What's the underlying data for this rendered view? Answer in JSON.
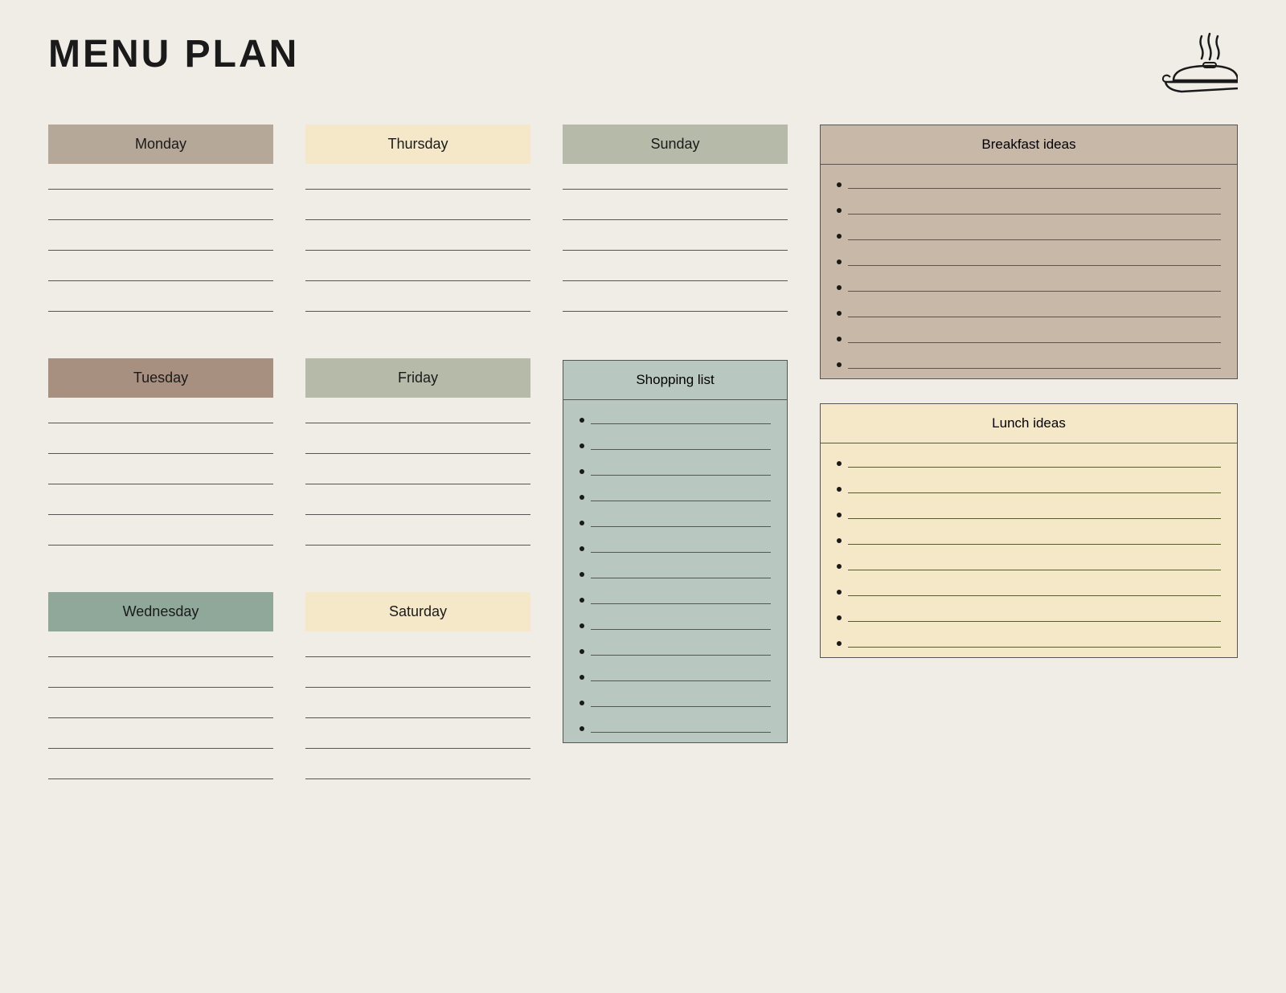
{
  "title": "MENU PLAN",
  "days": {
    "monday": {
      "label": "Monday",
      "color_class": "monday",
      "lines": 5
    },
    "tuesday": {
      "label": "Tuesday",
      "color_class": "tuesday",
      "lines": 5
    },
    "wednesday": {
      "label": "Wednesday",
      "color_class": "wednesday",
      "lines": 5
    },
    "thursday": {
      "label": "Thursday",
      "color_class": "thursday",
      "lines": 5
    },
    "friday": {
      "label": "Friday",
      "color_class": "friday",
      "lines": 5
    },
    "saturday": {
      "label": "Saturday",
      "color_class": "saturday",
      "lines": 5
    },
    "sunday": {
      "label": "Sunday",
      "color_class": "sunday",
      "lines": 5
    }
  },
  "shopping_list": {
    "title": "Shopping list",
    "bullets": 13
  },
  "breakfast_ideas": {
    "title": "Breakfast ideas",
    "bullets": 8
  },
  "lunch_ideas": {
    "title": "Lunch ideas",
    "bullets": 8
  }
}
